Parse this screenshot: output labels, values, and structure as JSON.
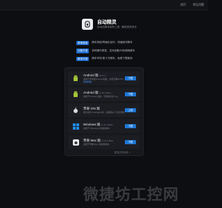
{
  "topnav": {
    "link1": "首页",
    "link2": "常见问题"
  },
  "brand": {
    "name": "自动精灵",
    "slogan": "自动化脚本制作工具 · 解放您的双手"
  },
  "features": [
    {
      "tag": "简单易用",
      "text": "脚本录制/界面化创作，快速制作脚本"
    },
    {
      "tag": "功能丰富",
      "text": "多种操作类型，支持设备/代码调用脚本"
    },
    {
      "tag": "脚本市场",
      "text": "脚本市场 数十万脚本，免费下载使用"
    }
  ],
  "downloads": [
    {
      "title": "Android 版",
      "version": "v6.27.0",
      "sub": "适用于手机和Android设备，支持无需ROOT",
      "link": "查看教程",
      "button": "下载"
    },
    {
      "title": "Android 版",
      "version": "v1.10.1 Beta",
      "sub": "适用于Android 设备，可模拟点击 bug",
      "link": "",
      "button": "下载"
    },
    {
      "title": "苹果 iOS 版",
      "version": "",
      "sub": "官方合作 TestFlight 版，请使用以下方式获取",
      "link": "",
      "button": "上线"
    },
    {
      "title": "Windows 版",
      "version": "v1.31.0 Beta",
      "sub": "适用于 Windows 系统的版本",
      "link": "",
      "button": "下载"
    },
    {
      "title": "苹果 Mac 版",
      "version": "v1.31.0 Beta",
      "sub": "适用于苹果 Mac 系统的版本",
      "link": "",
      "button": "下载"
    }
  ],
  "card_footer": "更多历史版本 >",
  "watermark": "微捷坊工控网"
}
